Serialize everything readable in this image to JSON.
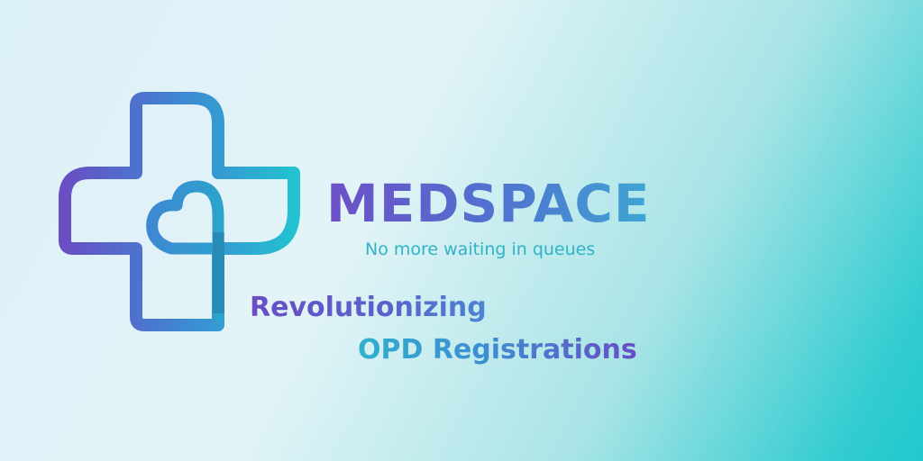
{
  "brand": {
    "name": "MEDSPACE",
    "tagline": "No more waiting in queues"
  },
  "headline": {
    "line1": "Revolutionizing",
    "line2": "OPD Registrations"
  },
  "logo": {
    "icon": "medical-cross-heart-icon"
  },
  "colors": {
    "primary_purple": "#6a4cc4",
    "primary_blue": "#3d8ed2",
    "accent_teal": "#2fb3c8",
    "background_light": "#e3f4f7",
    "background_teal": "#1fc8cc"
  }
}
